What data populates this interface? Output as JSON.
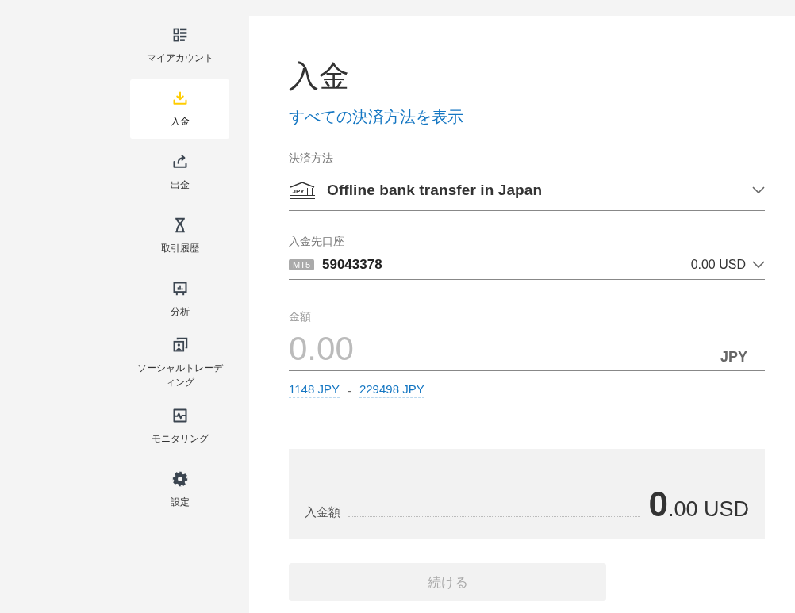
{
  "sidebar": {
    "items": [
      {
        "label": "マイアカウント",
        "selected": false
      },
      {
        "label": "入金",
        "selected": true
      },
      {
        "label": "出金",
        "selected": false
      },
      {
        "label": "取引履歴",
        "selected": false
      },
      {
        "label": "分析",
        "selected": false
      },
      {
        "label": "ソーシャルトレーディング",
        "selected": false
      },
      {
        "label": "モニタリング",
        "selected": false
      },
      {
        "label": "設定",
        "selected": false
      }
    ]
  },
  "page": {
    "title": "入金",
    "link": "すべての決済方法を表示"
  },
  "payment_method": {
    "label": "決済方法",
    "icon_text": "JPY",
    "value": "Offline bank transfer in Japan"
  },
  "account": {
    "label": "入金先口座",
    "badge": "MT5",
    "number": "59043378",
    "balance": "0.00 USD"
  },
  "amount": {
    "label": "金額",
    "placeholder": "0.00",
    "currency": "JPY",
    "min": "1148 JPY",
    "separator": "-",
    "max": "229498 JPY"
  },
  "summary": {
    "label": "入金額",
    "value": "**0**.00 USD"
  },
  "continue_button": {
    "label": "続ける",
    "disabled": true
  }
}
